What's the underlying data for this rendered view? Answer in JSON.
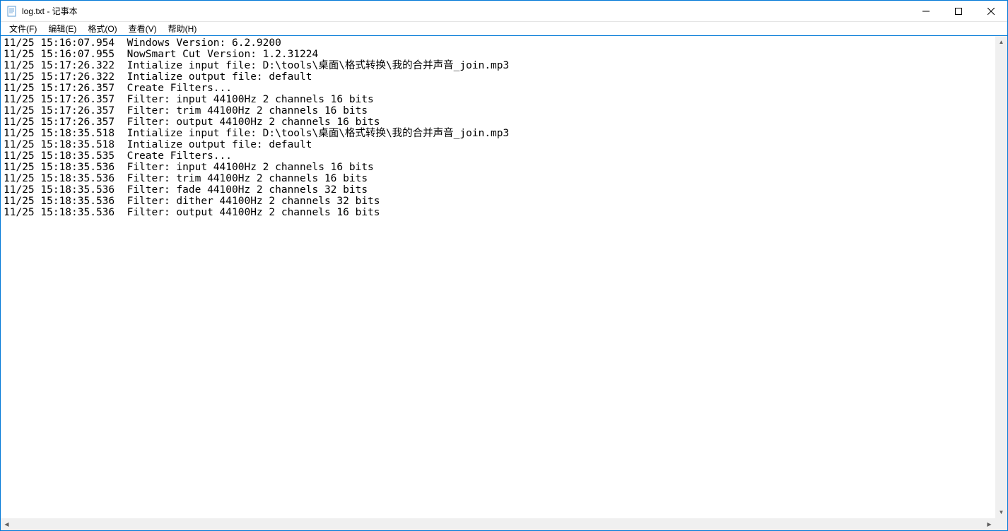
{
  "window": {
    "title": "log.txt - 记事本"
  },
  "menu": {
    "file": "文件(F)",
    "edit": "编辑(E)",
    "format": "格式(O)",
    "view": "查看(V)",
    "help": "帮助(H)"
  },
  "log_lines": [
    "11/25 15:16:07.954  Windows Version: 6.2.9200",
    "11/25 15:16:07.955  NowSmart Cut Version: 1.2.31224",
    "11/25 15:17:26.322  Intialize input file: D:\\tools\\桌面\\格式转换\\我的合并声音_join.mp3",
    "11/25 15:17:26.322  Intialize output file: default",
    "11/25 15:17:26.357  Create Filters...",
    "11/25 15:17:26.357  Filter: input 44100Hz 2 channels 16 bits",
    "11/25 15:17:26.357  Filter: trim 44100Hz 2 channels 16 bits",
    "11/25 15:17:26.357  Filter: output 44100Hz 2 channels 16 bits",
    "11/25 15:18:35.518  Intialize input file: D:\\tools\\桌面\\格式转换\\我的合并声音_join.mp3",
    "11/25 15:18:35.518  Intialize output file: default",
    "11/25 15:18:35.535  Create Filters...",
    "11/25 15:18:35.536  Filter: input 44100Hz 2 channels 16 bits",
    "11/25 15:18:35.536  Filter: trim 44100Hz 2 channels 16 bits",
    "11/25 15:18:35.536  Filter: fade 44100Hz 2 channels 32 bits",
    "11/25 15:18:35.536  Filter: dither 44100Hz 2 channels 32 bits",
    "11/25 15:18:35.536  Filter: output 44100Hz 2 channels 16 bits"
  ]
}
